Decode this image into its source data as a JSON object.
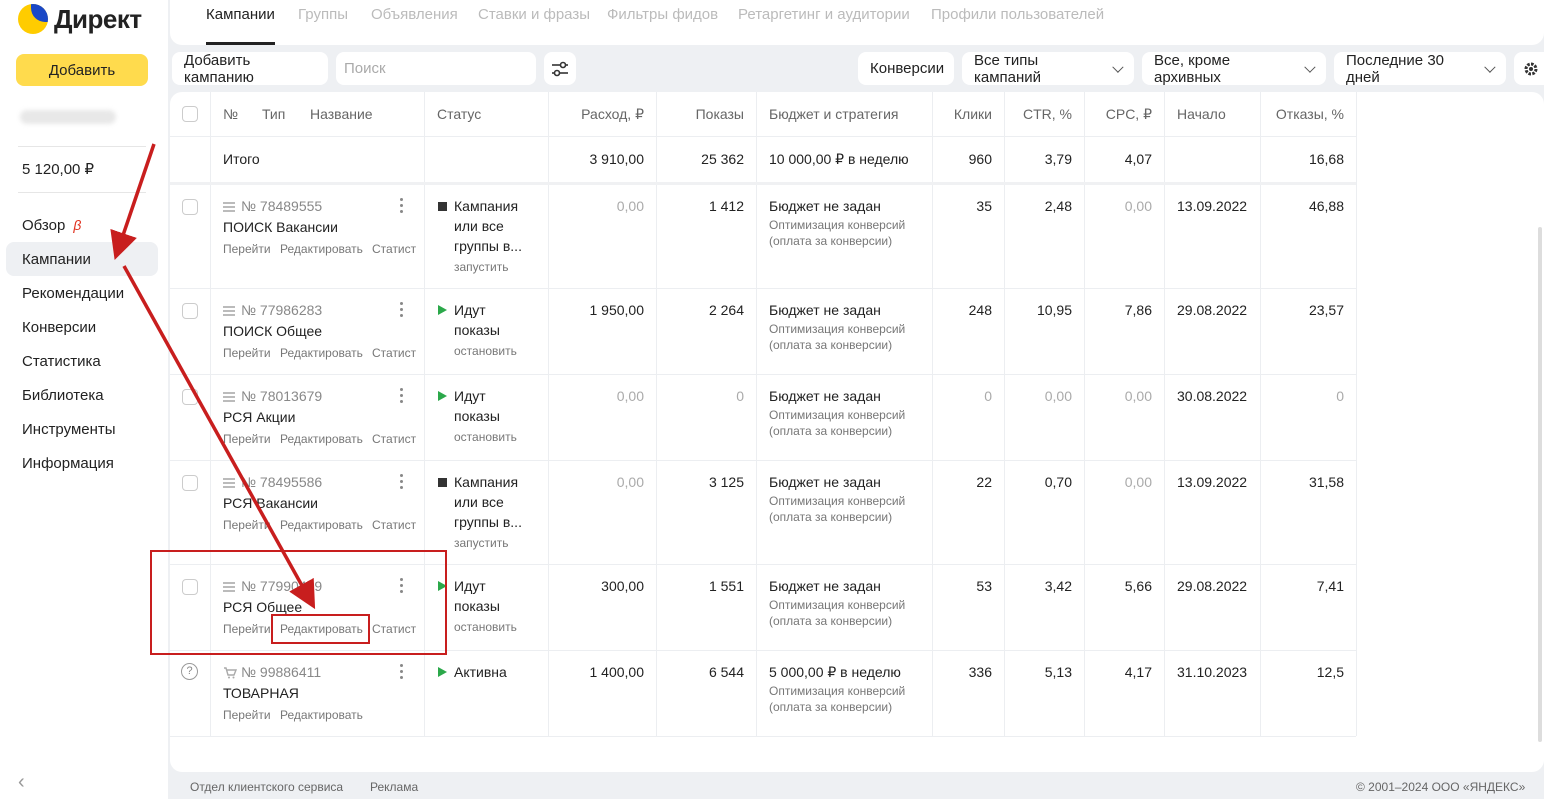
{
  "logo": {
    "text": "Директ"
  },
  "sidebar": {
    "add_label": "Добавить",
    "balance": "5 120,00 ₽",
    "beta": "β",
    "items": [
      {
        "label": "Обзор"
      },
      {
        "label": "Кампании"
      },
      {
        "label": "Рекомендации"
      },
      {
        "label": "Конверсии"
      },
      {
        "label": "Статистика"
      },
      {
        "label": "Библиотека"
      },
      {
        "label": "Инструменты"
      },
      {
        "label": "Информация"
      }
    ],
    "collapse": "‹"
  },
  "tabs": [
    {
      "label": "Кампании"
    },
    {
      "label": "Группы"
    },
    {
      "label": "Объявления"
    },
    {
      "label": "Ставки и фразы"
    },
    {
      "label": "Фильтры фидов"
    },
    {
      "label": "Ретаргетинг и аудитории"
    },
    {
      "label": "Профили пользователей"
    }
  ],
  "toolbar": {
    "add_campaign": "Добавить кампанию",
    "search_placeholder": "Поиск",
    "conversions": "Конверсии",
    "campaign_types": "Все типы кампаний",
    "archive_filter": "Все, кроме архивных",
    "period": "Последние 30 дней"
  },
  "table": {
    "headers": {
      "no": "№",
      "type": "Тип",
      "name": "Название",
      "status": "Статус",
      "spend": "Расход, ₽",
      "impressions": "Показы",
      "budget": "Бюджет и стратегия",
      "clicks": "Клики",
      "ctr": "CTR, %",
      "cpc": "CPC, ₽",
      "start": "Начало",
      "bounce": "Отказы, %"
    },
    "total": {
      "label": "Итого",
      "spend": "3 910,00",
      "impressions": "25 362",
      "budget": "10 000,00 ₽ в неделю",
      "clicks": "960",
      "ctr": "3,79",
      "cpc": "4,07",
      "bounce": "16,68"
    },
    "links": {
      "go": "Перейти",
      "edit": "Редактировать",
      "stats": "Статист"
    },
    "rows": [
      {
        "num": "№ 78489555",
        "name": "ПОИСК Вакансии",
        "status1": "Кампания",
        "status2": "или все",
        "status3": "группы в...",
        "action": "запустить",
        "spend": "0,00",
        "impressions": "1 412",
        "budget": "Бюджет не задан",
        "strategy1": "Оптимизация конверсий",
        "strategy2": "(оплата за конверсии)",
        "clicks": "35",
        "ctr": "2,48",
        "cpc": "0,00",
        "start": "13.09.2022",
        "bounce": "46,88"
      },
      {
        "num": "№ 77986283",
        "name": "ПОИСК Общее",
        "status1": "Идут",
        "status2": "показы",
        "action": "остановить",
        "spend": "1 950,00",
        "impressions": "2 264",
        "budget": "Бюджет не задан",
        "strategy1": "Оптимизация конверсий",
        "strategy2": "(оплата за конверсии)",
        "clicks": "248",
        "ctr": "10,95",
        "cpc": "7,86",
        "start": "29.08.2022",
        "bounce": "23,57"
      },
      {
        "num": "№ 78013679",
        "name": "РСЯ Акции",
        "status1": "Идут",
        "status2": "показы",
        "action": "остановить",
        "spend": "0,00",
        "impressions": "0",
        "budget": "Бюджет не задан",
        "strategy1": "Оптимизация конверсий",
        "strategy2": "(оплата за конверсии)",
        "clicks": "0",
        "ctr": "0,00",
        "cpc": "0,00",
        "start": "30.08.2022",
        "bounce": "0"
      },
      {
        "num": "№ 78495586",
        "name": "РСЯ Вакансии",
        "status1": "Кампания",
        "status2": "или все",
        "status3": "группы в...",
        "action": "запустить",
        "spend": "0,00",
        "impressions": "3 125",
        "budget": "Бюджет не задан",
        "strategy1": "Оптимизация конверсий",
        "strategy2": "(оплата за конверсии)",
        "clicks": "22",
        "ctr": "0,70",
        "cpc": "0,00",
        "start": "13.09.2022",
        "bounce": "31,58"
      },
      {
        "num": "№ 77990429",
        "name": "РСЯ Общее",
        "status1": "Идут",
        "status2": "показы",
        "action": "остановить",
        "spend": "300,00",
        "impressions": "1 551",
        "budget": "Бюджет не задан",
        "strategy1": "Оптимизация конверсий",
        "strategy2": "(оплата за конверсии)",
        "clicks": "53",
        "ctr": "3,42",
        "cpc": "5,66",
        "start": "29.08.2022",
        "bounce": "7,41"
      },
      {
        "num": "№ 99886411",
        "name": "ТОВАРНАЯ",
        "status1": "Активна",
        "spend": "1 400,00",
        "impressions": "6 544",
        "budget": "5 000,00 ₽ в неделю",
        "strategy1": "Оптимизация конверсий",
        "strategy2": "(оплата за конверсии)",
        "clicks": "336",
        "ctr": "5,13",
        "cpc": "4,17",
        "start": "31.10.2023",
        "bounce": "12,5"
      }
    ]
  },
  "footer": {
    "service": "Отдел клиентского сервиса",
    "ads": "Реклама",
    "copyright": "© 2001–2024 ООО «ЯНДЕКС»"
  },
  "colors": {
    "accent": "#ffdb4d",
    "annotation": "#c81e1e",
    "running": "#2ba84a"
  }
}
